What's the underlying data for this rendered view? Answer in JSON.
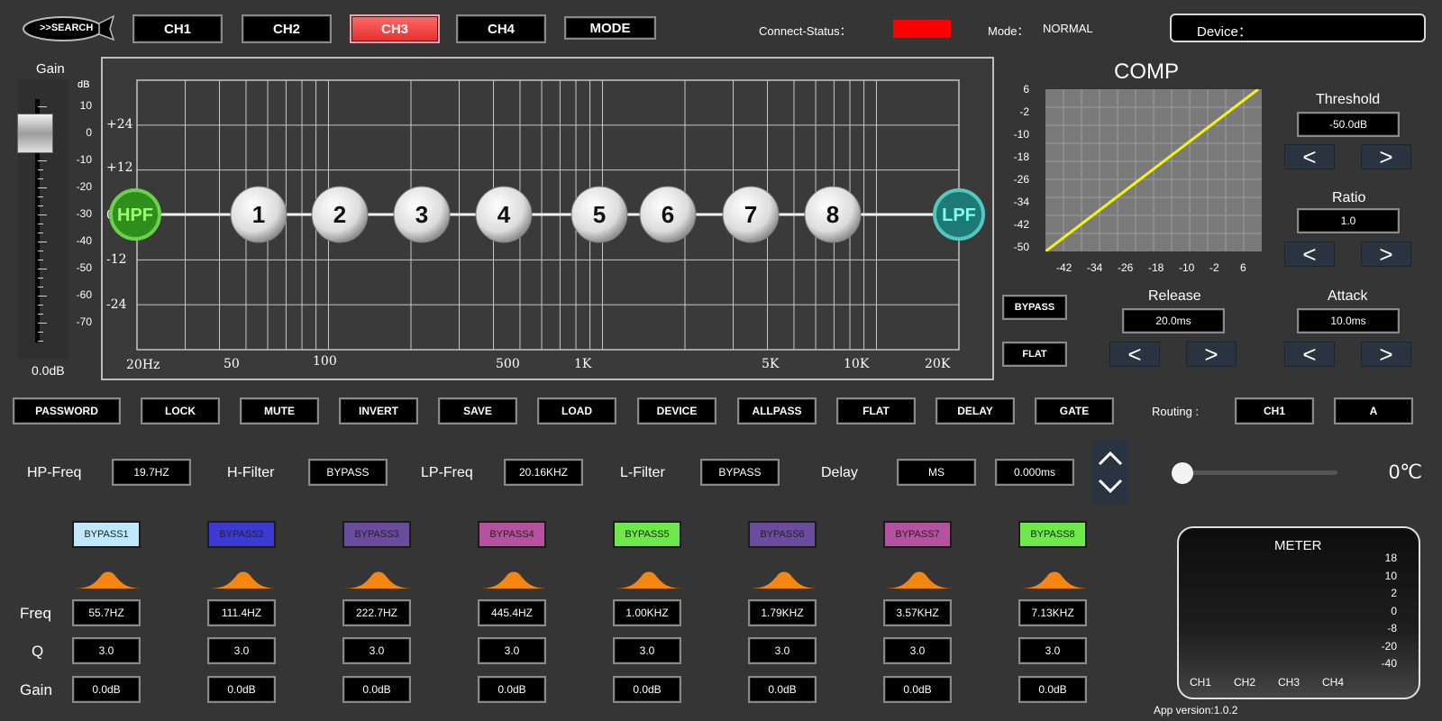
{
  "header": {
    "search_label": ">>SEARCH",
    "channels": [
      "CH1",
      "CH2",
      "CH3",
      "CH4"
    ],
    "active_channel": "CH3",
    "mode_button": "MODE",
    "connect_status_label": "Connect-Status：",
    "connect_status_color": "#ff0000",
    "mode_label": "Mode：",
    "mode_value": "NORMAL",
    "device_label": "Device："
  },
  "gain": {
    "title": "Gain",
    "unit": "dB",
    "scale": [
      "10",
      "0",
      "-10",
      "-20",
      "-30",
      "-40",
      "-50",
      "-60",
      "-70"
    ],
    "value": "0.0dB",
    "level_db": 0
  },
  "eq_graph": {
    "db_labels": [
      "+24",
      "+12",
      "0",
      "-12",
      "-24"
    ],
    "freq_labels": [
      "20Hz",
      "50",
      "100",
      "500",
      "1K",
      "5K",
      "10K",
      "20K"
    ],
    "hpf_label": "HPF",
    "lpf_label": "LPF",
    "points": [
      "1",
      "2",
      "3",
      "4",
      "5",
      "6",
      "7",
      "8"
    ]
  },
  "comp": {
    "title": "COMP",
    "y_ticks": [
      "6",
      "-2",
      "-10",
      "-18",
      "-26",
      "-34",
      "-42",
      "-50"
    ],
    "x_ticks": [
      "-42",
      "-34",
      "-26",
      "-18",
      "-10",
      "-2",
      "6"
    ],
    "threshold_label": "Threshold",
    "threshold_value": "-50.0dB",
    "ratio_label": "Ratio",
    "ratio_value": "1.0",
    "release_label": "Release",
    "release_value": "20.0ms",
    "attack_label": "Attack",
    "attack_value": "10.0ms",
    "bypass_button": "BYPASS",
    "flat_button": "FLAT",
    "curve_color": "#f3f316"
  },
  "toolbar": {
    "buttons": [
      "PASSWORD",
      "LOCK",
      "MUTE",
      "INVERT",
      "SAVE",
      "LOAD",
      "DEVICE",
      "ALLPASS",
      "FLAT",
      "DELAY",
      "GATE"
    ],
    "routing_label": "Routing :",
    "routing_channel": "CH1",
    "routing_output": "A"
  },
  "filters": {
    "hp_freq_label": "HP-Freq",
    "hp_freq_value": "19.7HZ",
    "h_filter_label": "H-Filter",
    "h_filter_value": "BYPASS",
    "lp_freq_label": "LP-Freq",
    "lp_freq_value": "20.16KHZ",
    "l_filter_label": "L-Filter",
    "l_filter_value": "BYPASS",
    "delay_label": "Delay",
    "delay_unit": "MS",
    "delay_value": "0.000ms",
    "temperature": "0℃"
  },
  "bands": {
    "freq_label": "Freq",
    "q_label": "Q",
    "gain_label": "Gain",
    "items": [
      {
        "bypass": "BYPASS1",
        "color": "#bfe9fb",
        "freq": "55.7HZ",
        "q": "3.0",
        "gain": "0.0dB"
      },
      {
        "bypass": "BYPASS2",
        "color": "#3b3bd1",
        "freq": "111.4HZ",
        "q": "3.0",
        "gain": "0.0dB"
      },
      {
        "bypass": "BYPASS3",
        "color": "#6a4c9c",
        "freq": "222.7HZ",
        "q": "3.0",
        "gain": "0.0dB"
      },
      {
        "bypass": "BYPASS4",
        "color": "#b5529f",
        "freq": "445.4HZ",
        "q": "3.0",
        "gain": "0.0dB"
      },
      {
        "bypass": "BYPASS5",
        "color": "#6ee84a",
        "freq": "1.00KHZ",
        "q": "3.0",
        "gain": "0.0dB"
      },
      {
        "bypass": "BYPASS6",
        "color": "#6a4c9c",
        "freq": "1.79KHZ",
        "q": "3.0",
        "gain": "0.0dB"
      },
      {
        "bypass": "BYPASS7",
        "color": "#b5529f",
        "freq": "3.57KHZ",
        "q": "3.0",
        "gain": "0.0dB"
      },
      {
        "bypass": "BYPASS8",
        "color": "#6ee84a",
        "freq": "7.13KHZ",
        "q": "3.0",
        "gain": "0.0dB"
      }
    ]
  },
  "meter": {
    "title": "METER",
    "scale": [
      "18",
      "10",
      "2",
      "0",
      "-8",
      "-20",
      "-40"
    ],
    "channels": [
      "CH1",
      "CH2",
      "CH3",
      "CH4"
    ]
  },
  "app_version": "App version:1.0.2"
}
